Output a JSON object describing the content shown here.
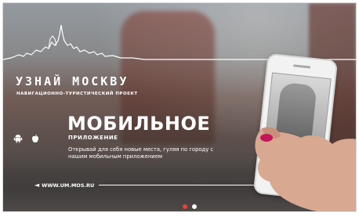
{
  "brand": {
    "title": "УЗНАЙ МОСКВУ",
    "subtitle": "НАВИГАЦИОННО-ТУРИСТИЧЕСКИЙ ПРОЕКТ"
  },
  "promo": {
    "headline": "МОБИЛЬНОЕ",
    "subhead": "ПРИЛОЖЕНИЕ",
    "description": "Открывай для себя новые места, гуляя по городу с нашим мобильным приложением"
  },
  "platforms": [
    "android-icon",
    "apple-icon"
  ],
  "url": "WWW.UM.MOS.RU",
  "carousel": {
    "slides": 2,
    "active_index": 0,
    "colors": {
      "active": "#e8423c",
      "inactive": "#ffffff"
    }
  }
}
